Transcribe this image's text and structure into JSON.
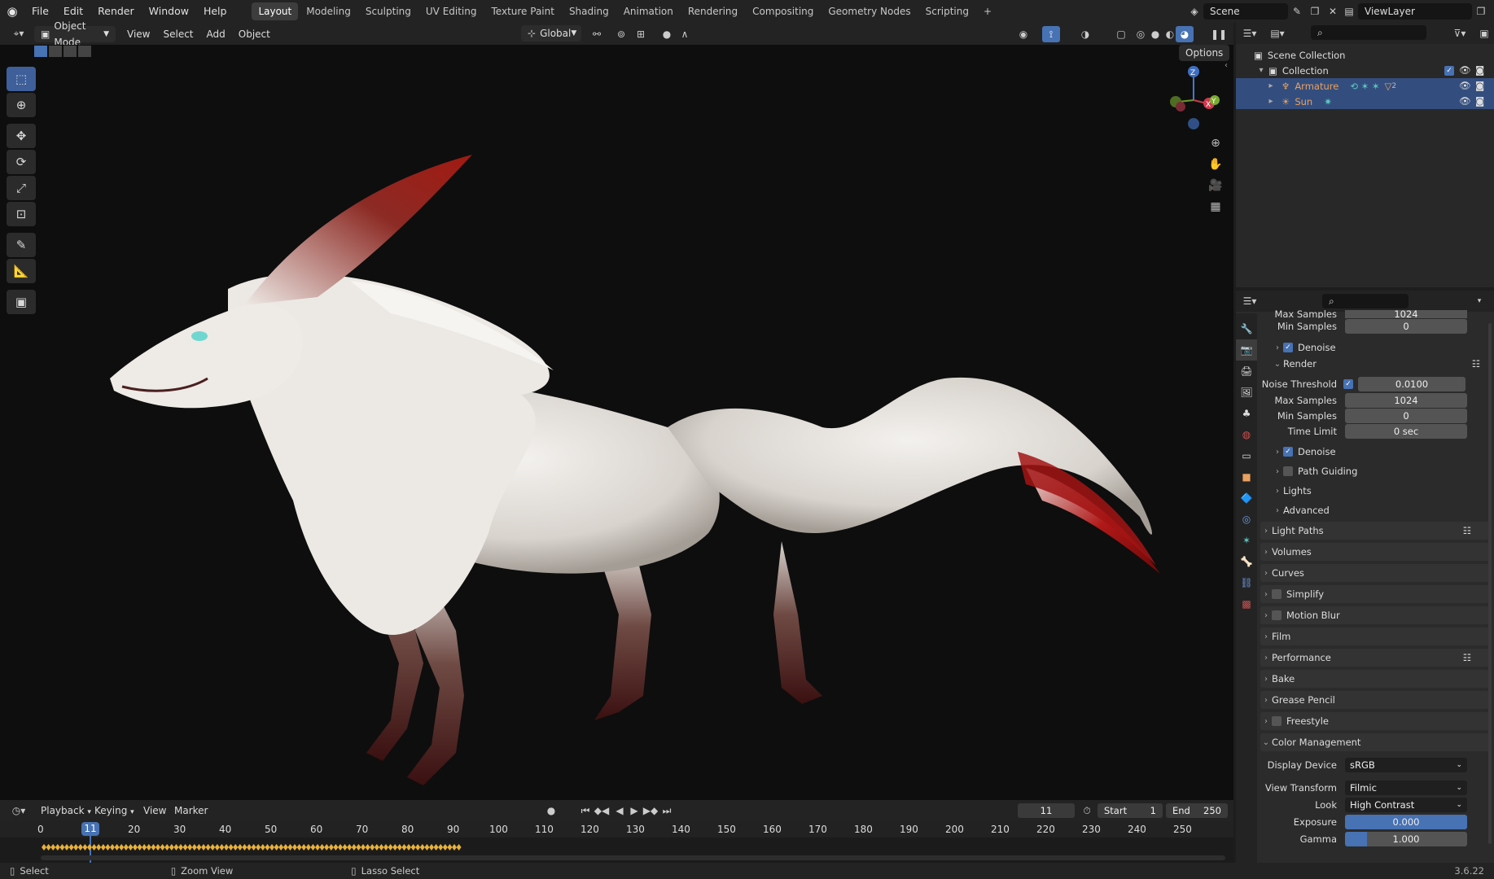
{
  "topbar": {
    "menus": [
      "File",
      "Edit",
      "Render",
      "Window",
      "Help"
    ],
    "workspaces": [
      "Layout",
      "Modeling",
      "Sculpting",
      "UV Editing",
      "Texture Paint",
      "Shading",
      "Animation",
      "Rendering",
      "Compositing",
      "Geometry Nodes",
      "Scripting"
    ],
    "active_workspace": "Layout",
    "add_tab": "+",
    "scene": "Scene",
    "view_layer": "ViewLayer"
  },
  "viewport_header": {
    "mode": "Object Mode",
    "menus": [
      "View",
      "Select",
      "Add",
      "Object"
    ],
    "orientation": "Global",
    "options": "Options"
  },
  "gizmo": {
    "z": "Z",
    "x": "X",
    "y": "Y"
  },
  "outliner": {
    "scene_collection": "Scene Collection",
    "collection": "Collection",
    "items": [
      {
        "name": "Armature",
        "color": "#e9a060",
        "badge": "2"
      },
      {
        "name": "Sun",
        "color": "#e9a060",
        "badge": ""
      }
    ]
  },
  "properties": {
    "clipped_top": {
      "label": "Max Samples",
      "value": "1024"
    },
    "rows_top": [
      {
        "label": "Min Samples",
        "value": "0"
      }
    ],
    "denoise_viewport": "Denoise",
    "render_section": "Render",
    "noise_threshold": {
      "label": "Noise Threshold",
      "value": "0.0100"
    },
    "render_rows": [
      {
        "label": "Max Samples",
        "value": "1024"
      },
      {
        "label": "Min Samples",
        "value": "0"
      },
      {
        "label": "Time Limit",
        "value": "0 sec"
      }
    ],
    "sub_panels": [
      "Denoise",
      "Path Guiding",
      "Lights",
      "Advanced"
    ],
    "panels": [
      "Light Paths",
      "Volumes",
      "Curves",
      "Simplify",
      "Motion Blur",
      "Film",
      "Performance",
      "Bake",
      "Grease Pencil",
      "Freestyle"
    ],
    "color_management": {
      "title": "Color Management",
      "display_device": {
        "label": "Display Device",
        "value": "sRGB"
      },
      "view_transform": {
        "label": "View Transform",
        "value": "Filmic"
      },
      "look": {
        "label": "Look",
        "value": "High Contrast"
      },
      "exposure": {
        "label": "Exposure",
        "value": "0.000"
      },
      "gamma": {
        "label": "Gamma",
        "value": "1.000"
      }
    }
  },
  "timeline": {
    "menus": [
      "Playback",
      "Keying",
      "View",
      "Marker"
    ],
    "current_frame": "11",
    "start_label": "Start",
    "start": "1",
    "end_label": "End",
    "end": "250",
    "ticks": [
      "0",
      "20",
      "30",
      "40",
      "50",
      "60",
      "70",
      "80",
      "90",
      "100",
      "110",
      "120",
      "130",
      "140",
      "150",
      "160",
      "170",
      "180",
      "190",
      "200",
      "210",
      "220",
      "230",
      "240",
      "250"
    ],
    "playhead": "11"
  },
  "status": {
    "items": [
      "Select",
      "Zoom View",
      "Lasso Select"
    ],
    "version": "3.6.22"
  },
  "colors": {
    "accent": "#4772b3",
    "keyframe": "#e8b13a",
    "selection": "#334e7e"
  }
}
